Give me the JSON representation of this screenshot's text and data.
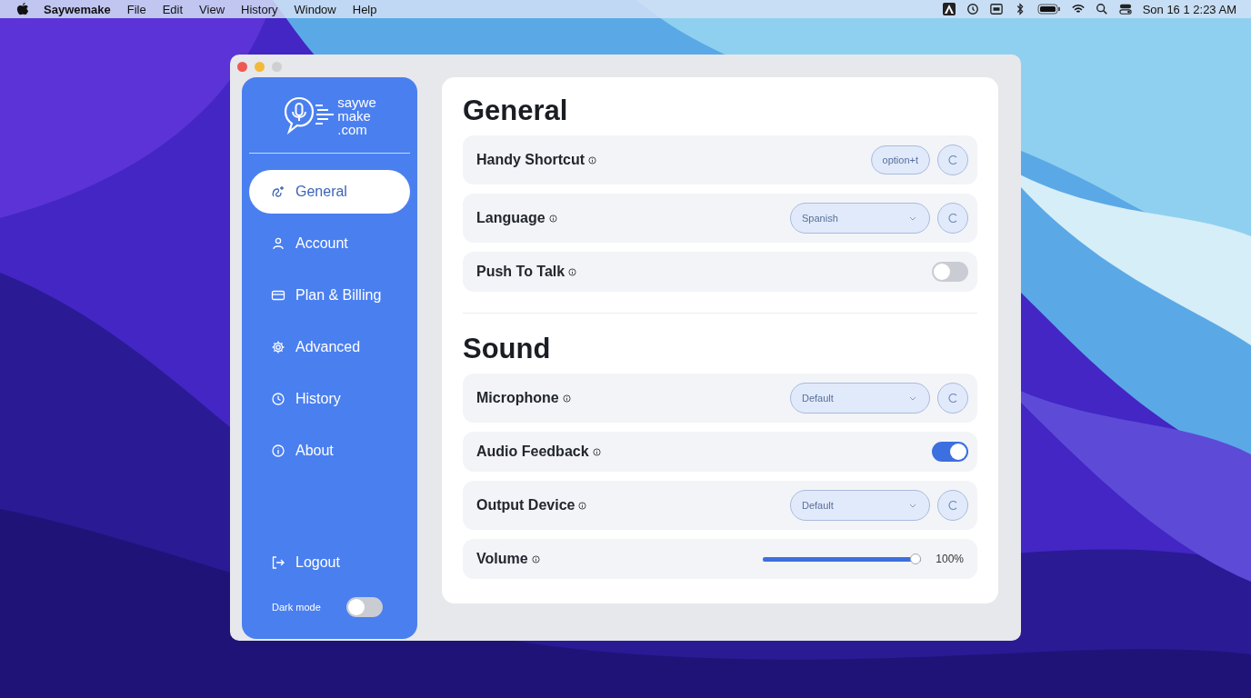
{
  "menu_bar": {
    "app": "Saywemake",
    "menus": [
      "File",
      "Edit",
      "View",
      "History",
      "Window",
      "Help"
    ],
    "clock": "Son 16 1 2:23 AM"
  },
  "sidebar": {
    "logo_lines": [
      "saywe",
      "make",
      ".com"
    ],
    "items": [
      {
        "label": "General",
        "kind": "sparkle",
        "selected": true
      },
      {
        "label": "Account",
        "kind": "person",
        "selected": false
      },
      {
        "label": "Plan & Billing",
        "kind": "card",
        "selected": false
      },
      {
        "label": "Advanced",
        "kind": "gear",
        "selected": false
      },
      {
        "label": "History",
        "kind": "clock",
        "selected": false
      },
      {
        "label": "About",
        "kind": "info",
        "selected": false
      }
    ],
    "logout": "Logout",
    "dark_mode": {
      "label": "Dark mode",
      "on": false
    }
  },
  "sections": [
    {
      "title": "General",
      "rows": [
        {
          "label": "Handy Shortcut",
          "kind": "shortcut",
          "value": "option+t"
        },
        {
          "label": "Language",
          "kind": "select",
          "value": "Spanish"
        },
        {
          "label": "Push To Talk",
          "kind": "toggle",
          "on": false
        }
      ]
    },
    {
      "title": "Sound",
      "rows": [
        {
          "label": "Microphone",
          "kind": "select",
          "value": "Default"
        },
        {
          "label": "Audio Feedback",
          "kind": "toggle",
          "on": true
        },
        {
          "label": "Output Device",
          "kind": "select",
          "value": "Default"
        },
        {
          "label": "Volume",
          "kind": "slider",
          "level": 1.0,
          "reading": "100%"
        }
      ]
    }
  ]
}
